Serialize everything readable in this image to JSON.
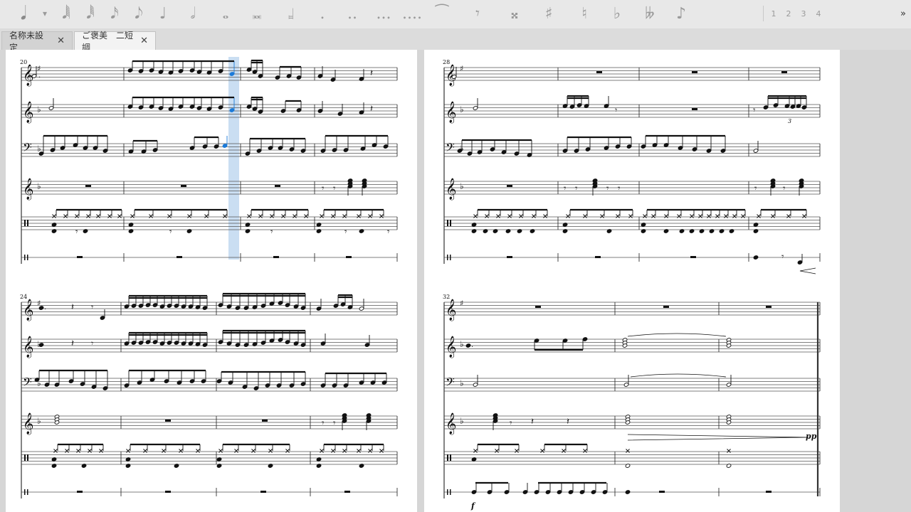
{
  "toolbar": {
    "app_icon": "note-input-icon",
    "buttons": [
      {
        "name": "note-input-mode-button",
        "glyph": "𝅘𝅥",
        "icon": "note-input-icon"
      },
      {
        "name": "input-mode-dropdown",
        "glyph": "▾",
        "icon": "chevron-down-icon"
      },
      {
        "name": "duration-64th-button",
        "glyph": "𝅘𝅥𝅲",
        "icon": "64th-note-icon"
      },
      {
        "name": "duration-32nd-button",
        "glyph": "𝅘𝅥𝅱",
        "icon": "32nd-note-icon"
      },
      {
        "name": "duration-16th-button",
        "glyph": "𝅘𝅥𝅯",
        "icon": "16th-note-icon"
      },
      {
        "name": "duration-8th-button",
        "glyph": "𝅘𝅥𝅮",
        "icon": "8th-note-icon"
      },
      {
        "name": "duration-quarter-button",
        "glyph": "♩",
        "icon": "quarter-note-icon"
      },
      {
        "name": "duration-half-button",
        "glyph": "𝅗𝅥",
        "icon": "half-note-icon"
      },
      {
        "name": "duration-whole-button",
        "glyph": "𝅝",
        "icon": "whole-note-icon"
      },
      {
        "name": "duration-breve-button",
        "glyph": "𝅜",
        "icon": "breve-icon"
      },
      {
        "name": "duration-longa-button",
        "glyph": "𝆷",
        "icon": "longa-icon"
      },
      {
        "name": "augmentation-dot-button",
        "glyph": ".",
        "icon": "dot-icon"
      },
      {
        "name": "double-dot-button",
        "glyph": "..",
        "icon": "double-dot-icon"
      },
      {
        "name": "triple-dot-button",
        "glyph": "...",
        "icon": "triple-dot-icon"
      },
      {
        "name": "quadruple-dot-button",
        "glyph": "....",
        "icon": "quadruple-dot-icon"
      },
      {
        "name": "tie-button",
        "glyph": "⁀",
        "icon": "tie-icon"
      },
      {
        "name": "rest-button",
        "glyph": "𝄾",
        "icon": "rest-icon"
      },
      {
        "name": "double-sharp-button",
        "glyph": "𝄪",
        "icon": "double-sharp-icon"
      },
      {
        "name": "sharp-button",
        "glyph": "♯",
        "icon": "sharp-icon"
      },
      {
        "name": "natural-button",
        "glyph": "♮",
        "icon": "natural-icon"
      },
      {
        "name": "flat-button",
        "glyph": "♭",
        "icon": "flat-icon"
      },
      {
        "name": "double-flat-button",
        "glyph": "𝄫",
        "icon": "double-flat-icon"
      },
      {
        "name": "flip-direction-button",
        "glyph": "♪",
        "icon": "flip-direction-icon"
      }
    ],
    "voices": [
      "1",
      "2",
      "3",
      "4"
    ],
    "overflow": "»"
  },
  "tabs": [
    {
      "label": "名称未設定",
      "close": "✕",
      "active": false
    },
    {
      "label": "ご褒美　二短調",
      "close": "✕",
      "active": true
    }
  ],
  "score": {
    "systems": [
      {
        "measure_number": "20"
      },
      {
        "measure_number": "28"
      },
      {
        "measure_number": "24"
      },
      {
        "measure_number": "32"
      }
    ],
    "dynamics": [
      "pp",
      "f"
    ],
    "triplet": "3",
    "selection_color": "#1a7ad9"
  },
  "colors": {
    "note": "#111111",
    "selected": "#1a7ad9",
    "highlight": "#b8d3ee"
  }
}
